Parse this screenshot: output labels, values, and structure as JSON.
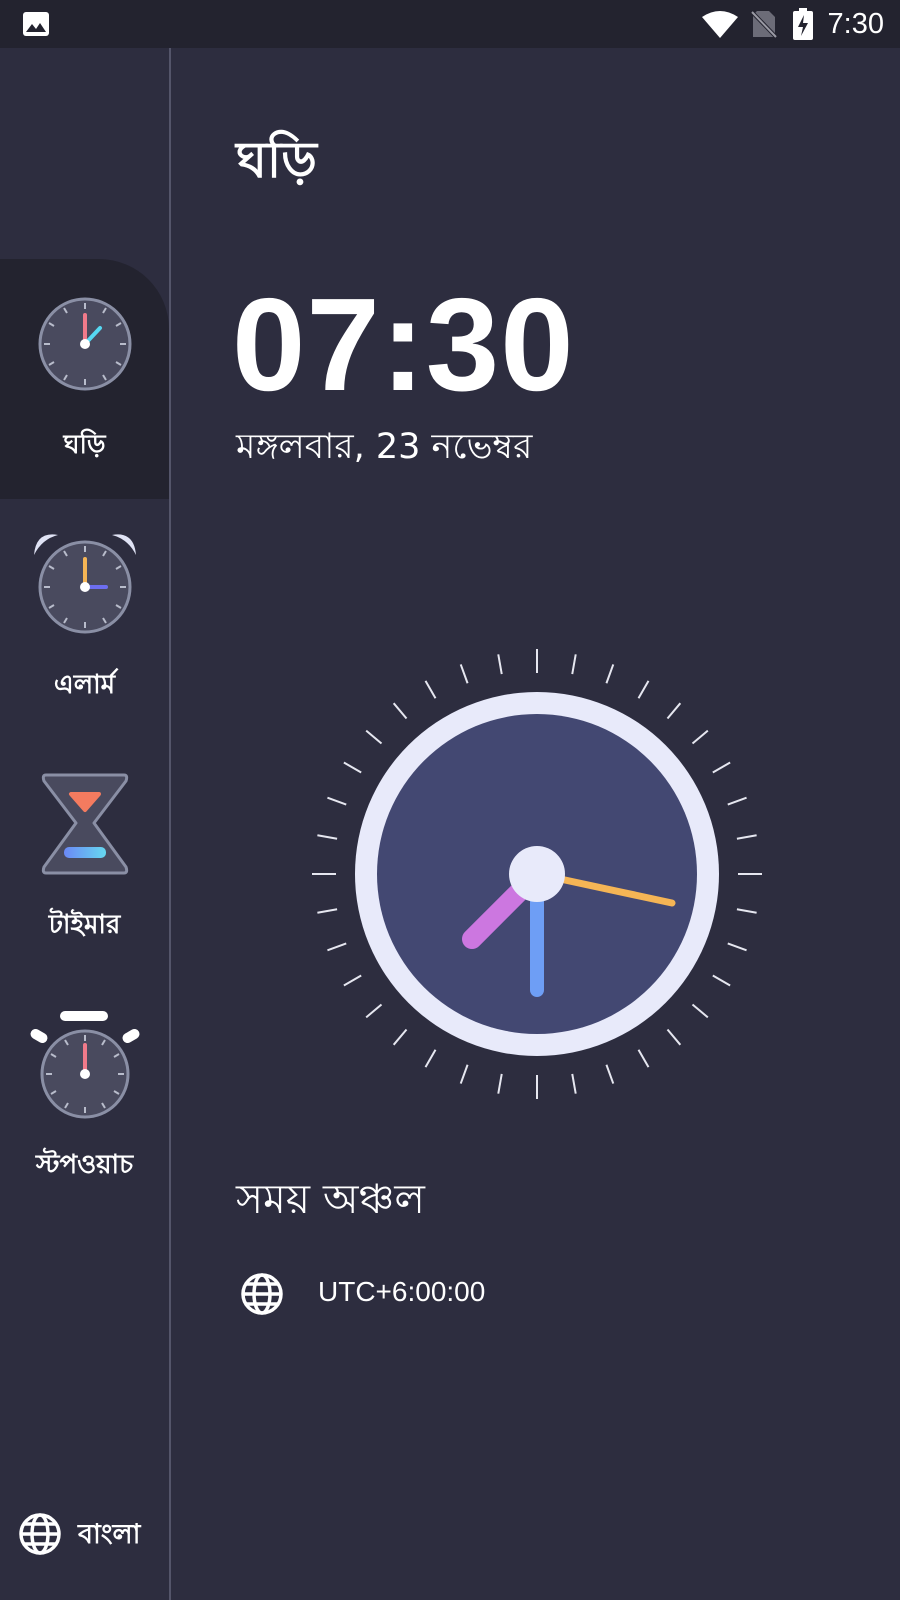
{
  "status_bar": {
    "time": "7:30",
    "icons": [
      "gallery-icon",
      "wifi-icon",
      "no-sim-icon",
      "battery-charging-icon"
    ]
  },
  "sidebar": {
    "items": [
      {
        "label": "ঘড়ি",
        "icon": "clock-icon",
        "active": true
      },
      {
        "label": "এলার্ম",
        "icon": "alarm-clock-icon",
        "active": false
      },
      {
        "label": "টাইমার",
        "icon": "hourglass-icon",
        "active": false
      },
      {
        "label": "স্টপওয়াচ",
        "icon": "stopwatch-icon",
        "active": false
      }
    ],
    "language": {
      "label": "বাংলা",
      "icon": "globe-icon"
    }
  },
  "main": {
    "title": "ঘড়ি",
    "time": "07:30",
    "date": "মঙ্গলবার, 23 নভেম্বর",
    "timezone_heading": "সময় অঞ্চল",
    "timezone_value": "UTC+6:00:00",
    "timezone_icon": "globe-icon"
  },
  "colors": {
    "background": "#2d2d3f",
    "status_bar": "#23232f",
    "clock_face": "#434872",
    "clock_ring": "#e8eafa",
    "hour_hand": "#cc77e0",
    "minute_hand": "#6e9ef5",
    "second_hand": "#f5b555"
  }
}
